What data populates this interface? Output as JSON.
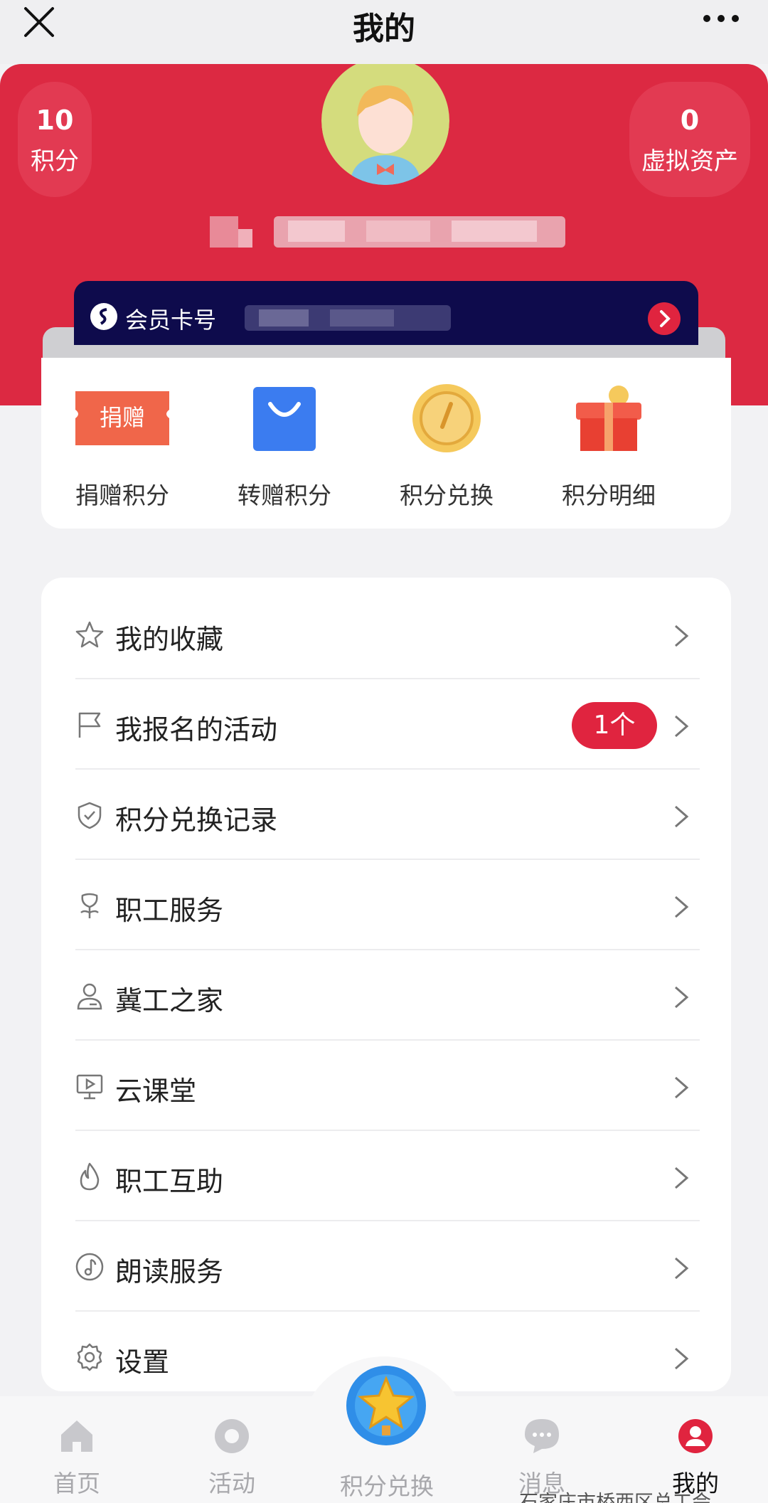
{
  "header": {
    "title": "我的"
  },
  "profile": {
    "points_value": "10",
    "points_label": "积分",
    "assets_value": "0",
    "assets_label": "虚拟资产",
    "member_card_label": "会员卡号"
  },
  "actions": [
    {
      "label": "捐赠积分",
      "icon_text": "捐赠",
      "icon": "donate-ticket-icon"
    },
    {
      "label": "转赠积分",
      "icon": "shopping-bag-icon"
    },
    {
      "label": "积分兑换",
      "icon": "gold-coin-icon"
    },
    {
      "label": "积分明细",
      "icon": "gift-box-icon"
    }
  ],
  "menu": [
    {
      "label": "我的收藏",
      "icon": "star-icon"
    },
    {
      "label": "我报名的活动",
      "icon": "flag-icon",
      "badge": "1个"
    },
    {
      "label": "积分兑换记录",
      "icon": "shield-check-icon"
    },
    {
      "label": "职工服务",
      "icon": "flower-icon"
    },
    {
      "label": "冀工之家",
      "icon": "person-icon"
    },
    {
      "label": "云课堂",
      "icon": "video-screen-icon"
    },
    {
      "label": "职工互助",
      "icon": "fire-icon"
    },
    {
      "label": "朗读服务",
      "icon": "music-note-icon"
    },
    {
      "label": "设置",
      "icon": "gear-icon"
    }
  ],
  "tabbar": [
    {
      "label": "首页",
      "icon": "home-icon"
    },
    {
      "label": "活动",
      "icon": "activity-icon"
    },
    {
      "label": "积分兑换",
      "icon": "star-trophy-icon"
    },
    {
      "label": "消息",
      "icon": "message-icon"
    },
    {
      "label": "我的",
      "icon": "profile-icon",
      "active": true
    }
  ],
  "watermark": "石家庄市桥西区总工会",
  "colors": {
    "brand_red": "#dc2942",
    "card_navy": "#0e0b4c",
    "badge_red": "#e0243f"
  }
}
